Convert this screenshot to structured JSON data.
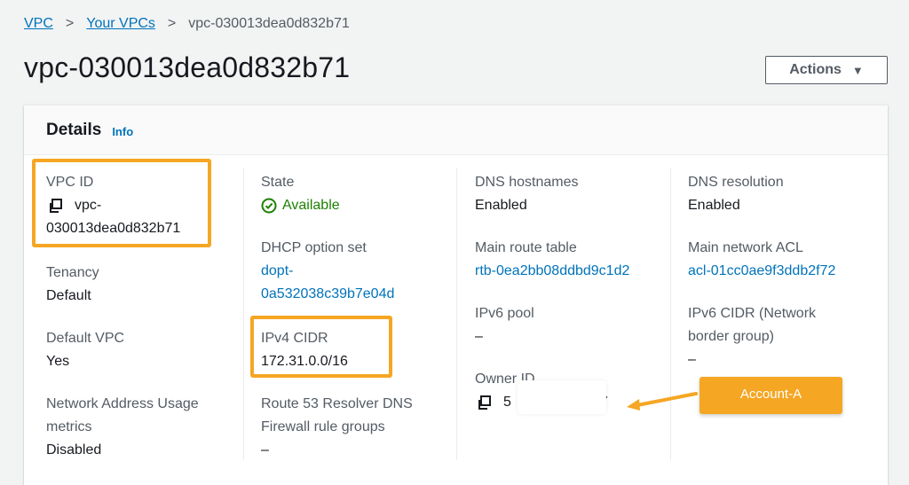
{
  "breadcrumb": {
    "items": [
      "VPC",
      "Your VPCs"
    ],
    "current": "vpc-030013dea0d832b71",
    "separator": ">"
  },
  "page_title": "vpc-030013dea0d832b71",
  "actions_button": {
    "label": "Actions",
    "icon": "caret-down-icon"
  },
  "details": {
    "title": "Details",
    "info_label": "Info",
    "columns": [
      [
        {
          "label": "VPC ID",
          "value_line1": "vpc-",
          "value_line2": "030013dea0d832b71",
          "copyable": true
        },
        {
          "label": "Tenancy",
          "value": "Default"
        },
        {
          "label": "Default VPC",
          "value": "Yes"
        },
        {
          "label_line1": "Network Address Usage",
          "label_line2": "metrics",
          "value": "Disabled"
        }
      ],
      [
        {
          "label": "State",
          "value": "Available",
          "status_icon": "check-circle-icon",
          "status_color": "#1d8102"
        },
        {
          "label": "DHCP option set",
          "value_line1": "dopt-",
          "value_line2": "0a532038c39b7e04d",
          "is_link": true
        },
        {
          "label": "IPv4 CIDR",
          "value": "172.31.0.0/16"
        },
        {
          "label_line1": "Route 53 Resolver DNS",
          "label_line2": "Firewall rule groups",
          "value": "–"
        }
      ],
      [
        {
          "label": "DNS hostnames",
          "value": "Enabled"
        },
        {
          "label": "Main route table",
          "value": "rtb-0ea2bb08ddbd9c1d2",
          "is_link": true
        },
        {
          "label": "IPv6 pool",
          "value": "–"
        },
        {
          "label": "Owner ID",
          "value_start": "5",
          "value_end": "7",
          "copyable": true
        }
      ],
      [
        {
          "label": "DNS resolution",
          "value": "Enabled"
        },
        {
          "label": "Main network ACL",
          "value": "acl-01cc0ae9f3ddb2f72",
          "is_link": true
        },
        {
          "label_line1": "IPv6 CIDR (Network",
          "label_line2": "border group)",
          "value": "–"
        }
      ]
    ]
  },
  "annotation": {
    "badge_label": "Account-A",
    "highlight_color": "#f5a623"
  },
  "colors": {
    "link": "#0073bb",
    "success": "#1d8102",
    "text": "#16191f",
    "label": "#545b64"
  }
}
